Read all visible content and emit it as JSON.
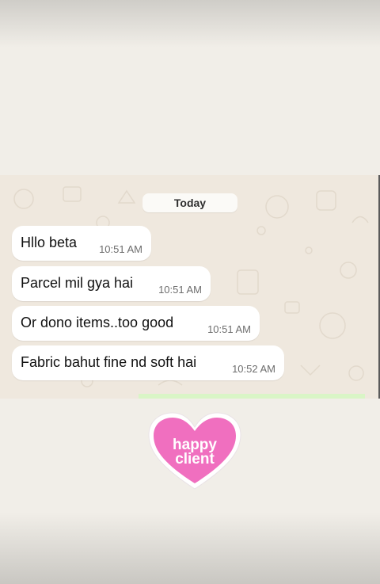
{
  "chat": {
    "date_label": "Today",
    "messages": [
      {
        "text": "Hllo beta",
        "time": "10:51 AM"
      },
      {
        "text": "Parcel mil gya hai",
        "time": "10:51 AM"
      },
      {
        "text": "Or dono items..too good",
        "time": "10:51 AM"
      },
      {
        "text": "Fabric bahut fine nd soft hai",
        "time": "10:52 AM"
      }
    ]
  },
  "sticker": {
    "line1": "happy",
    "line2": "client",
    "color": "#f06fbf"
  },
  "colors": {
    "chat_background": "#efe8de",
    "bubble": "#ffffff",
    "page_background": "#f1eee8"
  }
}
